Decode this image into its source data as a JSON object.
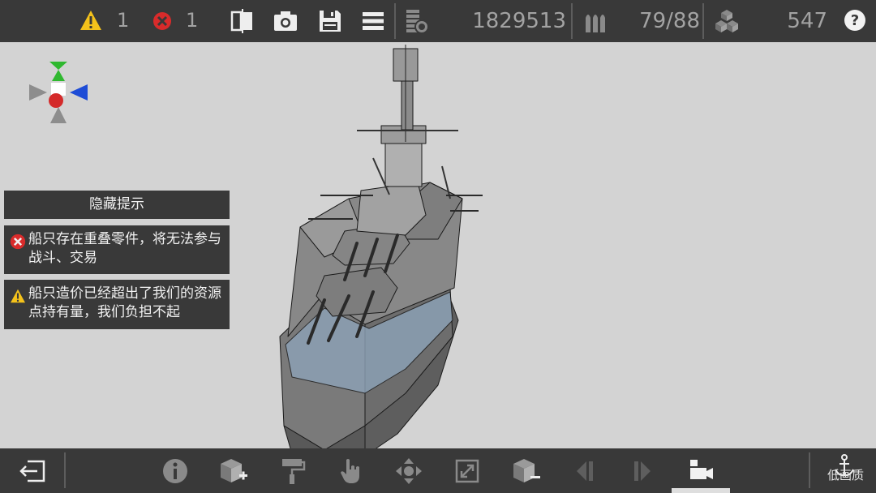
{
  "topbar": {
    "warning_count": "1",
    "error_count": "1",
    "resources": "1829513",
    "ammo": "79/88",
    "parts": "547",
    "icons": [
      "warning-icon",
      "error-icon",
      "mirror-icon",
      "camera-icon",
      "save-icon",
      "menu-icon",
      "coins-icon",
      "ammo-icon",
      "cubes-icon",
      "help-icon"
    ]
  },
  "panels": {
    "hide_tips": "隐藏提示",
    "error_msg": "船只存在重叠零件，将无法参与战斗、交易",
    "warning_msg": "船只造价已经超出了我们的资源点持有量，我们负担不起"
  },
  "bottombar": {
    "quality_label": "低画质",
    "icons": [
      "exit-icon",
      "info-icon",
      "add-part-icon",
      "paint-roller-icon",
      "hand-pointer-icon",
      "move-icon",
      "scale-icon",
      "remove-part-icon",
      "prev-icon",
      "next-icon",
      "camera-view-icon",
      "anchor-icon"
    ]
  },
  "colors": {
    "bar_bg": "#393939",
    "viewport_bg": "#d3d3d3",
    "warning": "#f4c21b",
    "error": "#d92b2b"
  }
}
